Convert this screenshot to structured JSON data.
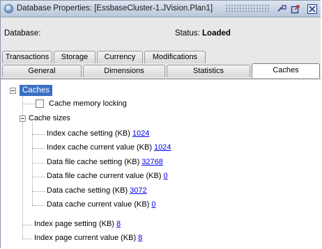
{
  "window": {
    "title": "Database Properties: [EssbaseCluster-1.JVision.Plan1]",
    "icons": [
      "app-icon",
      "float-icon",
      "maximize-icon",
      "close-icon"
    ]
  },
  "status_bar": {
    "database_label": "Database:",
    "status_label": "Status:",
    "status_value": "Loaded"
  },
  "tabs": {
    "row1": [
      "Transactions",
      "Storage",
      "Currency",
      "Modifications"
    ],
    "row2": [
      "General",
      "Dimensions",
      "Statistics",
      "Caches"
    ],
    "active": "Caches"
  },
  "tree": {
    "root": "Caches",
    "cache_memory_locking": "Cache memory locking",
    "cache_sizes": {
      "label": "Cache sizes",
      "items": [
        {
          "label": "Index cache setting (KB)",
          "value": "1024"
        },
        {
          "label": "Index cache current value (KB)",
          "value": "1024"
        },
        {
          "label": "Data file cache setting (KB)",
          "value": "32768"
        },
        {
          "label": "Data file cache current value (KB)",
          "value": "0"
        },
        {
          "label": "Data cache setting (KB)",
          "value": "3072"
        },
        {
          "label": "Data cache current value (KB)",
          "value": "0"
        }
      ]
    },
    "index_page_setting": {
      "label": "Index page setting (KB)",
      "value": "8"
    },
    "index_page_current": {
      "label": "Index page current value (KB)",
      "value": "8"
    }
  },
  "colors": {
    "selection": "#3b6fc4",
    "link": "#0000ee",
    "titlebar": "#c9d5e6"
  }
}
